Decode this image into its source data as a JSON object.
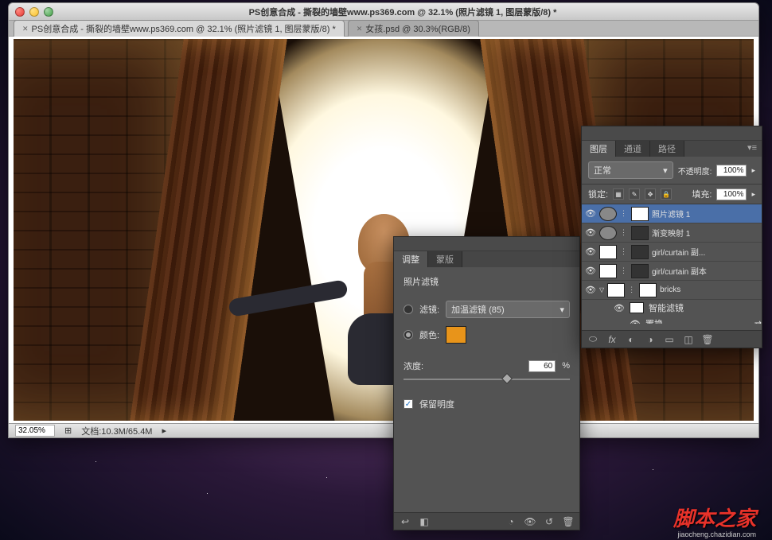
{
  "window": {
    "title": "PS创意合成 - 撕裂的墙壁www.ps369.com @ 32.1% (照片滤镜 1, 图层蒙版/8) *"
  },
  "tabs": [
    {
      "label": "PS创意合成 - 撕裂的墙壁www.ps369.com @ 32.1% (照片滤镜 1, 图层蒙版/8) *"
    },
    {
      "label": "女孩.psd @ 30.3%(RGB/8)"
    }
  ],
  "status": {
    "zoom": "32.05%",
    "doc": "文档:10.3M/65.4M"
  },
  "adjust": {
    "tab1": "调整",
    "tab2": "蒙版",
    "title": "照片滤镜",
    "filterLabel": "滤镜:",
    "filterValue": "加温滤镜 (85)",
    "colorLabel": "颜色:",
    "colorHex": "#e8941a",
    "densityLabel": "浓度:",
    "densityValue": "60",
    "densityPercent": "%",
    "preserveLabel": "保留明度"
  },
  "layers": {
    "tab1": "图层",
    "tab2": "通道",
    "tab3": "路径",
    "blendMode": "正常",
    "opacityLabel": "不透明度:",
    "opacityValue": "100%",
    "lockLabel": "锁定:",
    "fillLabel": "填充:",
    "fillValue": "100%",
    "items": [
      {
        "name": "照片滤镜 1",
        "sel": true,
        "adj": true
      },
      {
        "name": "渐变映射 1",
        "adj": true
      },
      {
        "name": "girl/curtain 副...",
        "mask": true
      },
      {
        "name": "girl/curtain 副本",
        "mask": true
      },
      {
        "name": "bricks",
        "smart": true
      }
    ],
    "smartLabel": "智能滤镜",
    "displaceLabel": "置换"
  },
  "watermark": "脚本之家",
  "watermark2": "jiaocheng.chazidian.com"
}
